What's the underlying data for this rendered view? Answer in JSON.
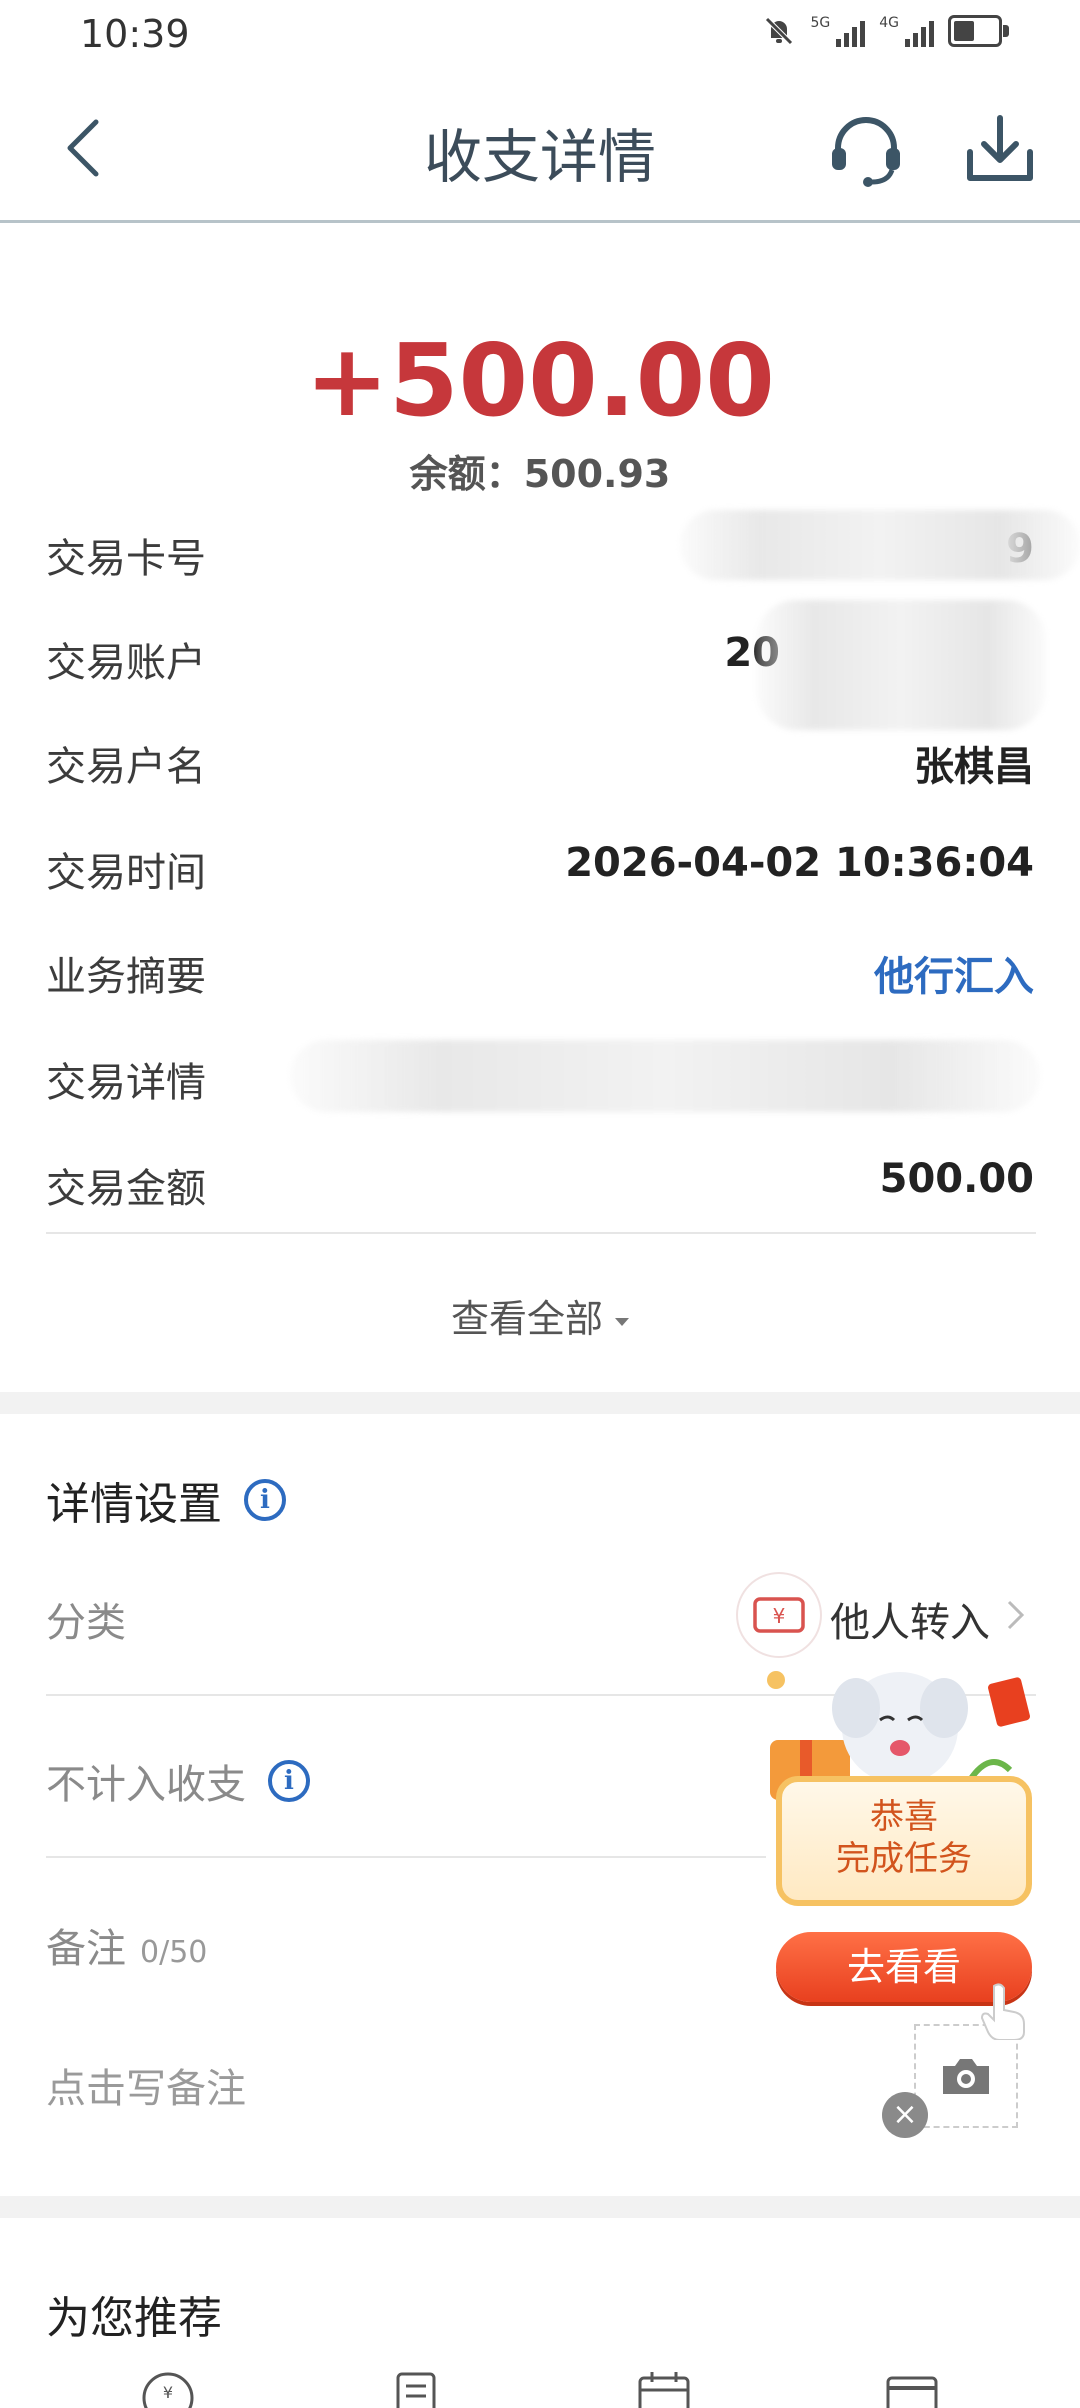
{
  "status_bar": {
    "time": "10:39",
    "net1": "5G",
    "net2": "4G"
  },
  "header": {
    "title": "收支详情"
  },
  "amount": "+500.00",
  "balance": {
    "label": "余额：",
    "value": "500.93"
  },
  "info_rows": [
    {
      "label": "交易卡号",
      "value": "6212",
      "suffix": "9"
    },
    {
      "label": "交易账户",
      "value": "20"
    },
    {
      "label": "交易户名",
      "value": "张棋昌"
    },
    {
      "label": "交易时间",
      "value": "2026-04-02 10:36:04"
    },
    {
      "label": "业务摘要",
      "value": "他行汇入"
    },
    {
      "label": "交易详情",
      "value": ""
    },
    {
      "label": "交易金额",
      "value": "500.00"
    }
  ],
  "view_all": "查看全部",
  "settings": {
    "title": "详情设置",
    "category_label": "分类",
    "category_value": "他人转入",
    "exclude_label": "不计入收支",
    "note_label": "备注",
    "note_count": "0/50",
    "note_placeholder": "点击写备注"
  },
  "promo": {
    "line1": "恭喜",
    "line2": "完成任务",
    "button": "去看看"
  },
  "recommend": {
    "title": "为您推荐"
  },
  "colors": {
    "amount": "#c6373b",
    "link_blue": "#2d6bc0",
    "promo_orange": "#e8401f"
  }
}
